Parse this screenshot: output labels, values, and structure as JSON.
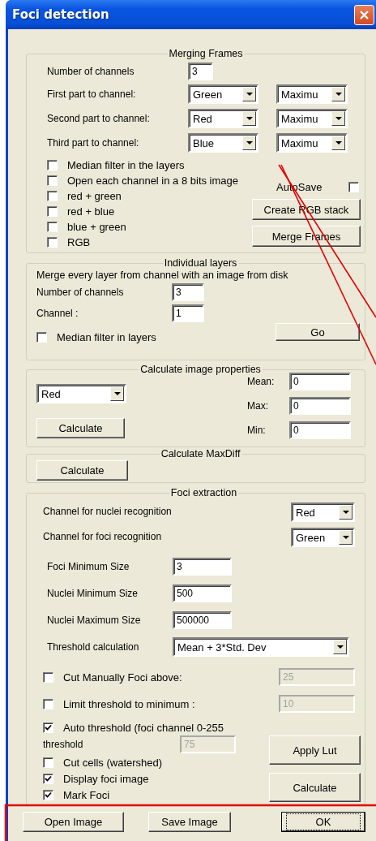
{
  "window": {
    "title": "Foci detection"
  },
  "merging_frames": {
    "title": "Merging Frames",
    "channels_label": "Number of channels",
    "channels_value": "3",
    "parts": [
      {
        "label": "First part to channel:",
        "channel": "Green",
        "mode": "Maximu"
      },
      {
        "label": "Second part to channel:",
        "channel": "Red",
        "mode": "Maximu"
      },
      {
        "label": "Third part to channel:",
        "channel": "Blue",
        "mode": "Maximu"
      }
    ],
    "checkboxes": [
      {
        "label": "Median filter in the layers",
        "checked": false
      },
      {
        "label": "Open each channel in a 8 bits image",
        "checked": false
      },
      {
        "label": "red + green",
        "checked": false
      },
      {
        "label": "red + blue",
        "checked": false
      },
      {
        "label": "blue + green",
        "checked": false
      },
      {
        "label": "RGB",
        "checked": false
      }
    ],
    "autosave": {
      "label": "AutoSave",
      "checked": false
    },
    "buttons": [
      "Create RGB stack",
      "Merge Frames"
    ]
  },
  "individual_layers": {
    "title": "Individual layers",
    "description": "Merge every layer from channel with an image from disk",
    "fields": [
      {
        "label": "Number of channels",
        "value": "3"
      },
      {
        "label": "Channel :",
        "value": "1"
      }
    ],
    "median_filter": {
      "label": "Median filter in layers",
      "checked": false
    },
    "button": "Go"
  },
  "image_properties": {
    "title": "Calculate image properties",
    "channel": "Red",
    "button": "Calculate",
    "stats": [
      {
        "label": "Mean:",
        "value": "0"
      },
      {
        "label": "Max:",
        "value": "0"
      },
      {
        "label": "Min:",
        "value": "0"
      }
    ]
  },
  "max_diff": {
    "title": "Calculate MaxDiff",
    "button": "Calculate"
  },
  "foci_extraction": {
    "title": "Foci extraction",
    "channel_selects": [
      {
        "label": "Channel for nuclei recognition",
        "value": "Red"
      },
      {
        "label": "Channel for foci recognition",
        "value": "Green"
      }
    ],
    "size_fields": [
      {
        "label": "Foci Minimum Size",
        "value": "3"
      },
      {
        "label": "Nuclei Minimum Size",
        "value": "500"
      },
      {
        "label": "Nuclei Maximum Size",
        "value": "500000"
      }
    ],
    "threshold_calculation": {
      "label": "Threshold calculation",
      "value": "Mean + 3*Std. Dev"
    },
    "limits": [
      {
        "label": "Cut Manually Foci above:",
        "checked": false,
        "value": "25",
        "disabled": true
      },
      {
        "label": "Limit threshold to minimum :",
        "checked": false,
        "value": "10",
        "disabled": true
      }
    ],
    "auto_threshold": {
      "label": "Auto threshold (foci channel 0-255",
      "checked": true
    },
    "threshold": {
      "label": "threshold",
      "value": "75",
      "disabled": true
    },
    "options": [
      {
        "label": "Cut cells (watershed)",
        "checked": false
      },
      {
        "label": "Display foci image",
        "checked": true
      },
      {
        "label": "Mark Foci",
        "checked": true
      }
    ],
    "buttons": [
      "Apply Lut",
      "Calculate"
    ]
  },
  "footer_buttons": [
    {
      "label": "Open Image",
      "default": false
    },
    {
      "label": "Save Image",
      "default": false
    },
    {
      "label": "OK",
      "default": true
    }
  ]
}
